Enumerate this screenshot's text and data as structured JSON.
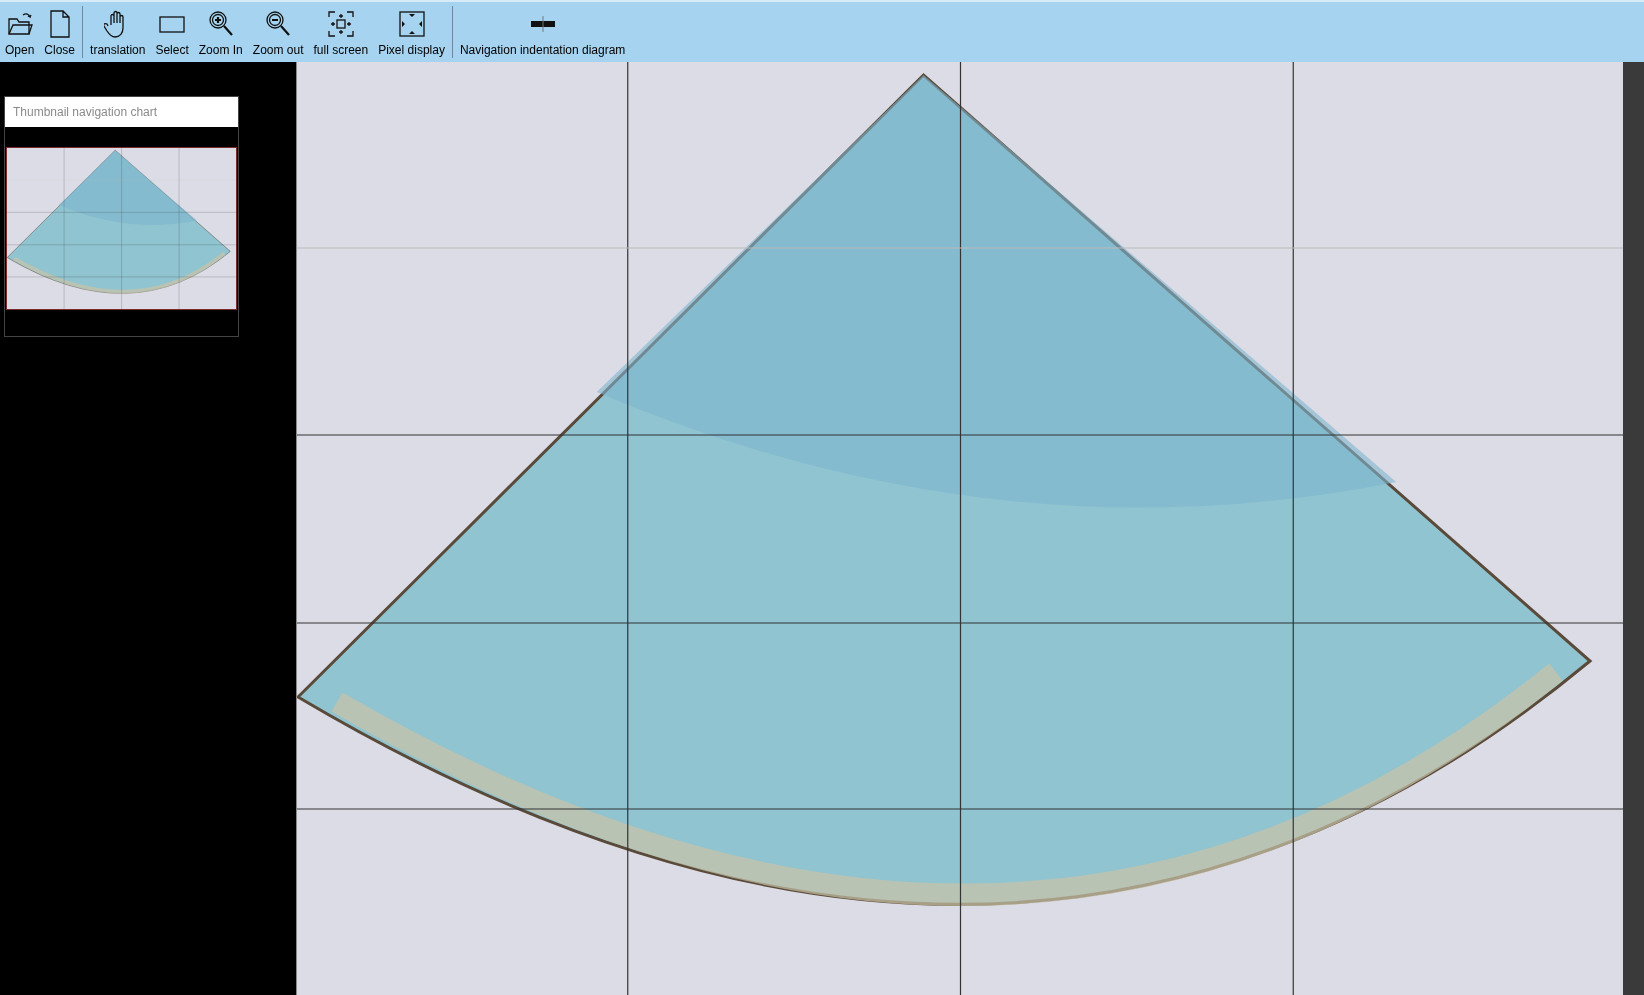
{
  "toolbar": {
    "groups": [
      [
        "Open",
        "Close"
      ],
      [
        "translation",
        "Select",
        "Zoom In",
        "Zoom out",
        "full screen",
        "Pixel display"
      ],
      [
        "Navigation indentation diagram"
      ]
    ]
  },
  "thumbnail_panel": {
    "title": "Thumbnail navigation chart"
  }
}
